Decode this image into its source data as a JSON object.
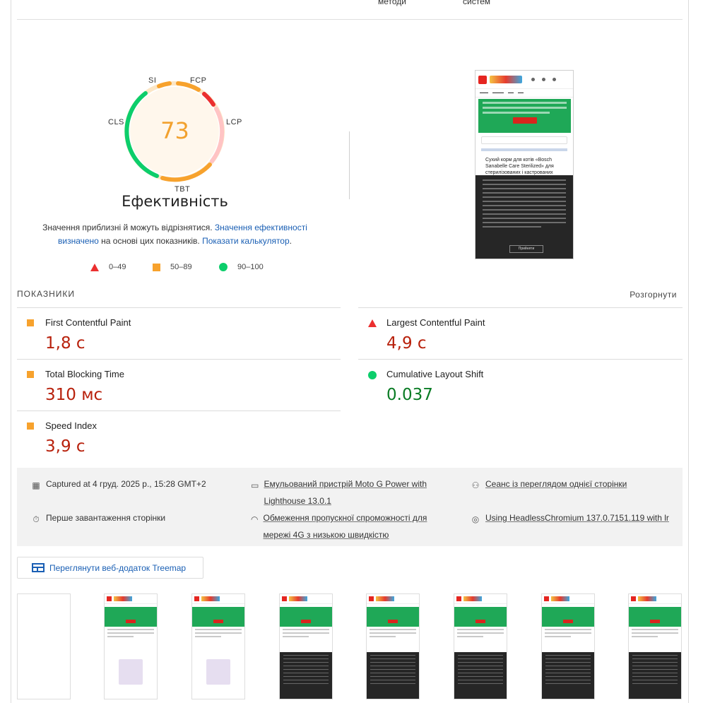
{
  "top_columns": [
    "методи",
    "систем"
  ],
  "performance": {
    "score": "73",
    "title": "Ефективність",
    "labels": {
      "si": "SI",
      "fcp": "FCP",
      "lcp": "LCP",
      "tbt": "TBT",
      "cls": "CLS"
    },
    "disclaimer_text1": "Значення приблизні й можуть відрізнятися. ",
    "disclaimer_link1": "Значення ефективності визначено",
    "disclaimer_text2": " на основі цих показників. ",
    "disclaimer_link2": "Показати калькулятор",
    "disclaimer_text3": ".",
    "score_fraction": 0.73
  },
  "legend": {
    "fail": "0–49",
    "average": "50–89",
    "pass": "90–100"
  },
  "colors": {
    "fail": "#eb2f2f",
    "average": "#f7a22d",
    "pass": "#0cce6b",
    "link": "#1a5fb4"
  },
  "screenshot": {
    "title": "Сухий корм для котів «Bosch Sanabelle Care Sterilized» для стерилізованих і кастрованих",
    "accept": "Прийняти"
  },
  "metrics_header": "ПОКАЗНИКИ",
  "expand_label": "Розгорнути",
  "metrics": [
    {
      "name": "First Contentful Paint",
      "value": "1,8 с",
      "status": "average"
    },
    {
      "name": "Largest Contentful Paint",
      "value": "4,9 с",
      "status": "fail"
    },
    {
      "name": "Total Blocking Time",
      "value": "310 мс",
      "status": "average"
    },
    {
      "name": "Cumulative Layout Shift",
      "value": "0.037",
      "status": "pass"
    },
    {
      "name": "Speed Index",
      "value": "3,9 с",
      "status": "average"
    }
  ],
  "info": {
    "captured": "Captured at 4 груд. 2025 р., 15:28 GMT+2",
    "device": "Емульований пристрій Moto G Power with Lighthouse 13.0.1",
    "session": "Сеанс із переглядом однієї сторінки",
    "load": "Перше завантаження сторінки",
    "throttling": "Обмеження пропускної спроможності для мережі 4G з низькою швидкістю",
    "browser": "Using HeadlessChromium 137.0.7151.119 with lr",
    "icons": [
      "calendar-icon",
      "laptop-icon",
      "people-icon",
      "stopwatch-icon",
      "wifi-icon",
      "chrome-icon"
    ]
  },
  "treemap_label": "Переглянути веб-додаток Treemap"
}
